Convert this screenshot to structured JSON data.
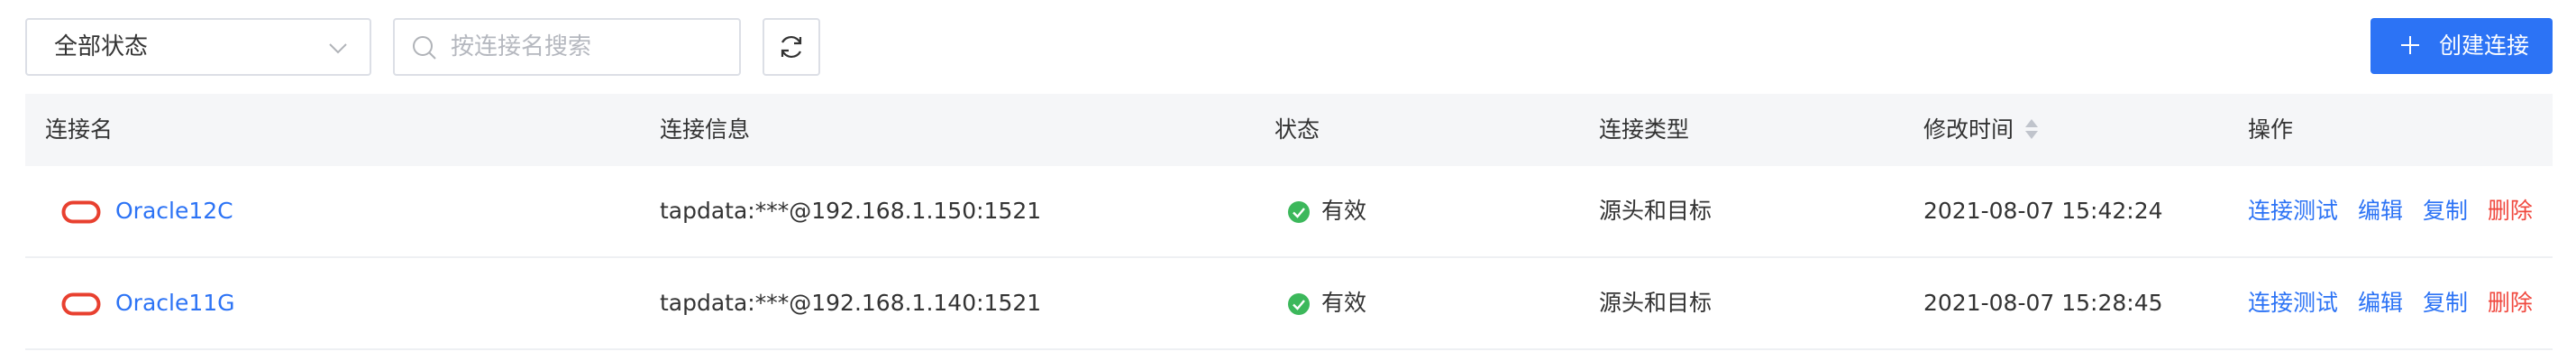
{
  "filter": {
    "status_value": "全部状态"
  },
  "search": {
    "placeholder": "按连接名搜索"
  },
  "toolbar": {
    "create_label": "创建连接"
  },
  "colors": {
    "primary": "#2c73f5",
    "danger": "#f0483e",
    "success": "#3cb85b",
    "oracle": "#e8402f"
  },
  "table": {
    "headers": {
      "name": "连接名",
      "info": "连接信息",
      "status": "状态",
      "type": "连接类型",
      "modified": "修改时间",
      "actions": "操作"
    },
    "rows": [
      {
        "icon": "oracle-logo-icon",
        "name": "Oracle12C",
        "info": "tapdata:***@192.168.1.150:1521",
        "status": "有效",
        "type": "源头和目标",
        "modified": "2021-08-07 15:42:24",
        "actions": {
          "test": "连接测试",
          "edit": "编辑",
          "copy": "复制",
          "delete": "删除"
        }
      },
      {
        "icon": "oracle-logo-icon",
        "name": "Oracle11G",
        "info": "tapdata:***@192.168.1.140:1521",
        "status": "有效",
        "type": "源头和目标",
        "modified": "2021-08-07 15:28:45",
        "actions": {
          "test": "连接测试",
          "edit": "编辑",
          "copy": "复制",
          "delete": "删除"
        }
      }
    ]
  }
}
